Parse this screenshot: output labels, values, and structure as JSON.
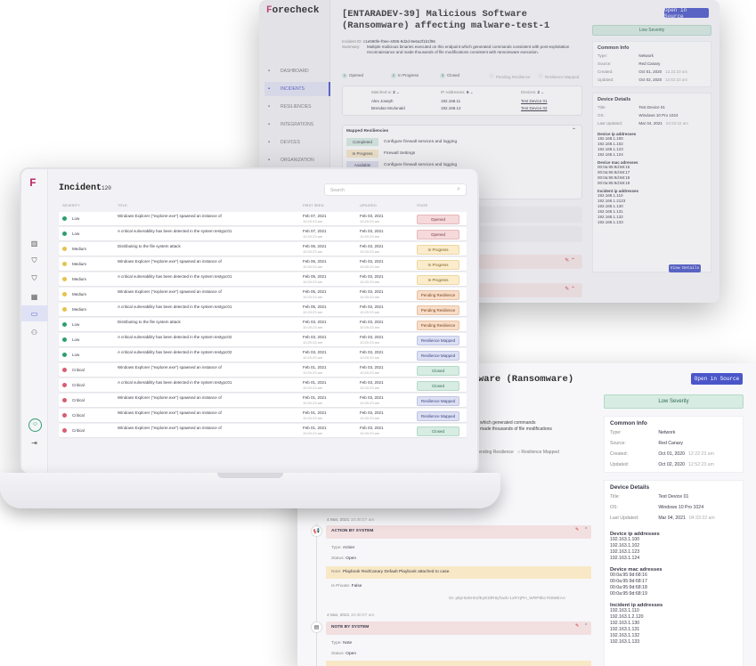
{
  "brand": {
    "name": "orecheck"
  },
  "back": {
    "title": "[ENTARADEV-39] Malicious Software (Ransomware) affecting malware-test-1",
    "open_button": "Open in Source",
    "severity": "Low Severity",
    "incident_id_label": "Incident ID:",
    "incident_id": "c1e590fe-f0ee-4085-9d2d-9e6a2f1b1f96",
    "summary_label": "Summary:",
    "summary": "Multiple malicious binaries executed on this endpoint which generated commands consistent with post-exploitation reconnaissance and made thousands of file modifications consistent with ransomware execution.",
    "nav": [
      {
        "label": "DASHBOARD",
        "icon": "chart-icon"
      },
      {
        "label": "INCIDENTS",
        "icon": "shield-icon",
        "active": true
      },
      {
        "label": "RESILIENCIES",
        "icon": "shield-check-icon"
      },
      {
        "label": "INTEGRATIONS",
        "icon": "grid-icon"
      },
      {
        "label": "DEVICES",
        "icon": "monitor-icon"
      },
      {
        "label": "ORGANIZATION",
        "icon": "users-icon"
      }
    ],
    "steps": [
      {
        "n": "1",
        "label": "Opened"
      },
      {
        "n": "2",
        "label": "In Progress"
      },
      {
        "n": "3",
        "label": "Closed"
      },
      {
        "n": "",
        "label": "Pending Resilience"
      },
      {
        "n": "",
        "label": "Resilience Mapped"
      }
    ],
    "watch": {
      "matched_label": "Matched w:",
      "matched_n": "2",
      "ip_label": "IP Addresses:",
      "ip_n": "6",
      "dev_label": "Devices:",
      "dev_n": "2",
      "rows": [
        {
          "name": "Alex Joseph",
          "ip": "192.168.11",
          "dev": "Test Device 01"
        },
        {
          "name": "Brendan Mcdonald",
          "ip": "192.168.12",
          "dev": "Test Device 02"
        }
      ]
    },
    "mapped_title": "Mapped Resiliencies",
    "mapped": [
      {
        "status": "Completed",
        "text": "Configure firewall services and logging"
      },
      {
        "status": "In Progress",
        "text": "Firewall Settings"
      },
      {
        "status": "Available",
        "text": "Configure firewall services and logging"
      }
    ],
    "common_title": "Common Info",
    "common": [
      {
        "k": "Type:",
        "v": "Network"
      },
      {
        "k": "Source:",
        "v": "Red Canary"
      },
      {
        "k": "Created:",
        "v": "Oct 01, 2020",
        "t": "12:22:23 am"
      },
      {
        "k": "Updated:",
        "v": "Oct 02, 2020",
        "t": "12:52:23 am"
      }
    ],
    "device_title": "Device Details",
    "device": [
      {
        "k": "Title:",
        "v": "Test Device 01"
      },
      {
        "k": "OS:",
        "v": "Windows 10 Pro 1024"
      },
      {
        "k": "Last Updated:",
        "v": "Mar 04, 2021",
        "t": "04:33:22 am"
      }
    ],
    "dip_title": "Device ip addresses",
    "dip": [
      "192.168.1.100",
      "192.168.1.102",
      "192.168.1.123",
      "192.168.1.124"
    ],
    "mac_title": "Device mac adresses",
    "mac": [
      "00:0a:95:9d:68:16",
      "00:0a:95:9d:68:17",
      "00:0a:95:9d:68:18",
      "00:0a:95:9d:68:19"
    ],
    "iip_title": "Incident ip addresses",
    "iip": [
      "192.168.1.110",
      "192.168.1.2123",
      "192.168.1.130",
      "192.168.1.131",
      "192.168.1.132",
      "192.168.1.133"
    ],
    "view_details": "View Details"
  },
  "incident": {
    "title": "Incident",
    "count": "120",
    "search_placeholder": "Search",
    "columns": [
      "SEVERITY",
      "TITLE",
      "FIRST SEEN",
      "UPDATED",
      "STATE"
    ],
    "rows": [
      {
        "sev": "Low",
        "title": "Windows Explorer (\"explorer.exe\") spawned an instance of",
        "fs": "Feb 07, 2021",
        "fst": "10:20:23 am",
        "up": "Feb 03, 2021",
        "upt": "10:20:23 am",
        "state": "Opened",
        "cls": "s-opened"
      },
      {
        "sev": "Low",
        "title": "A critical vulnerability has been detected in the system testypc01",
        "fs": "Feb 07, 2021",
        "fst": "10:20:23 am",
        "up": "Feb 03, 2021",
        "upt": "10:20:23 am",
        "state": "Opened",
        "cls": "s-opened"
      },
      {
        "sev": "Medium",
        "title": "Distributing to the file system attack",
        "fs": "Feb 06, 2021",
        "fst": "10:20:23 am",
        "up": "Feb 03, 2021",
        "upt": "10:20:23 am",
        "state": "In Progress",
        "cls": "s-progress"
      },
      {
        "sev": "Medium",
        "title": "Windows Explorer (\"explorer.exe\") spawned an instance of",
        "fs": "Feb 06, 2021",
        "fst": "10:20:23 am",
        "up": "Feb 03, 2021",
        "upt": "10:20:23 am",
        "state": "In Progress",
        "cls": "s-progress"
      },
      {
        "sev": "Medium",
        "title": "A critical vulnerability has been detected in the system testypc01",
        "fs": "Feb 05, 2021",
        "fst": "10:20:23 am",
        "up": "Feb 03, 2021",
        "upt": "10:20:23 am",
        "state": "In Progress",
        "cls": "s-progress"
      },
      {
        "sev": "Medium",
        "title": "Windows Explorer (\"explorer.exe\") spawned an instance of",
        "fs": "Feb 05, 2021",
        "fst": "10:20:23 am",
        "up": "Feb 03, 2021",
        "upt": "10:20:23 am",
        "state": "Pending Resilience",
        "cls": "s-pending"
      },
      {
        "sev": "Medium",
        "title": "A critical vulnerability has been detected in the system testypc01",
        "fs": "Feb 05, 2021",
        "fst": "10:20:23 am",
        "up": "Feb 03, 2021",
        "upt": "10:20:23 am",
        "state": "Pending Resilience",
        "cls": "s-pending"
      },
      {
        "sev": "Low",
        "title": "Distributing to the file system attack",
        "fs": "Feb 03, 2021",
        "fst": "10:20:23 am",
        "up": "Feb 03, 2021",
        "upt": "10:20:23 am",
        "state": "Pending Resilience",
        "cls": "s-pending"
      },
      {
        "sev": "Low",
        "title": "A critical vulnerability has been detected in the system testypc02",
        "fs": "Feb 03, 2021",
        "fst": "10:20:23 am",
        "up": "Feb 03, 2021",
        "upt": "10:20:23 am",
        "state": "Resilience Mapped",
        "cls": "s-mapped"
      },
      {
        "sev": "Low",
        "title": "A critical vulnerability has been detected in the system testypc02",
        "fs": "Feb 03, 2021",
        "fst": "10:20:23 am",
        "up": "Feb 03, 2021",
        "upt": "10:20:23 am",
        "state": "Resilience Mapped",
        "cls": "s-mapped"
      },
      {
        "sev": "Critical",
        "title": "Windows Explorer (\"explorer.exe\") spawned an instance of",
        "fs": "Feb 01, 2021",
        "fst": "10:20:23 am",
        "up": "Feb 03, 2021",
        "upt": "10:20:23 am",
        "state": "Closed",
        "cls": "s-closed"
      },
      {
        "sev": "Critical",
        "title": "A critical vulnerability has been detected in the system testypc01",
        "fs": "Feb 01, 2021",
        "fst": "10:20:23 am",
        "up": "Feb 03, 2021",
        "upt": "10:20:23 am",
        "state": "Closed",
        "cls": "s-closed"
      },
      {
        "sev": "Critical",
        "title": "Windows Explorer (\"explorer.exe\") spawned an instance of",
        "fs": "Feb 01, 2021",
        "fst": "10:20:23 am",
        "up": "Feb 03, 2021",
        "upt": "10:20:23 am",
        "state": "Resilience Mapped",
        "cls": "s-mapped"
      },
      {
        "sev": "Critical",
        "title": "Windows Explorer (\"explorer.exe\") spawned an instance of",
        "fs": "Feb 01, 2021",
        "fst": "10:20:23 am",
        "up": "Feb 03, 2021",
        "upt": "10:20:23 am",
        "state": "Resilience Mapped",
        "cls": "s-mapped"
      },
      {
        "sev": "Critical",
        "title": "Windows Explorer (\"explorer.exe\") spawned an instance of",
        "fs": "Feb 01, 2021",
        "fst": "10:20:23 am",
        "up": "Feb 03, 2021",
        "upt": "10:20:23 am",
        "state": "Closed",
        "cls": "s-closed"
      }
    ]
  },
  "front": {
    "title_tail": "ware (Ransomware)",
    "open_button": "Open in Source",
    "severity": "Low Severity",
    "summary_tail1": "which generated commands",
    "summary_tail2": "made thousands of file modifications",
    "steps_tail": [
      "Pending Resilience",
      "Resilience Mapped"
    ],
    "common_title": "Common Info",
    "common": [
      {
        "k": "Type:",
        "v": "Network"
      },
      {
        "k": "Source:",
        "v": "Red Canary"
      },
      {
        "k": "Created:",
        "v": "Oct 01, 2020",
        "t": "12:22:23 am"
      },
      {
        "k": "Updated:",
        "v": "Oct 02, 2020",
        "t": "12:52:23 am"
      }
    ],
    "device_title": "Device Details",
    "device": [
      {
        "k": "Title:",
        "v": "Test Device 01"
      },
      {
        "k": "OS:",
        "v": "Windows 10 Pro 1024"
      },
      {
        "k": "Last Updated:",
        "v": "Mar 04, 2021",
        "t": "04:33:22 am"
      }
    ],
    "dip_title": "Device ip addresses",
    "dip": [
      "192.163.1.100",
      "192.163.1.102",
      "192.163.1.123",
      "192.163.1.124"
    ],
    "mac_title": "Device mac adresses",
    "mac": [
      "00:0a:95:9d:68:16",
      "00:0a:95:9d:68:17",
      "00:0a:95:9d:68:18",
      "00:0a:95:9d:68:19"
    ],
    "iip_title": "Incident ip addresses",
    "iip": [
      "192.163.1.110",
      "192.163.1.2.120",
      "192.163.1.130",
      "192.163.1.131",
      "192.163.1.132",
      "192.163.1.133"
    ],
    "t1_date": "4 Mar, 2021",
    "t1_time": "10:30:07 am",
    "t1_title": "ACTION BY SYSTEM",
    "t1_type": "Action",
    "t1_status": "Open",
    "t1_note": "Playbook RedCanary Default Playbook attached to case.",
    "t1_private": "False",
    "t1_id": "pEjHt25H01fEyEDlR9yfowb-1xRYjPH_WRP8bcYkt58EAA",
    "t2_date": "4 Mar, 2021",
    "t2_time": "10:30:07 am",
    "t2_title": "NOTE BY SYSTEM",
    "t2_type": "Note",
    "t2_status": "Open",
    "labels": {
      "type": "Type:",
      "status": "Status:",
      "note": "Note:",
      "private": "Is Private:",
      "id": "ID:"
    }
  }
}
